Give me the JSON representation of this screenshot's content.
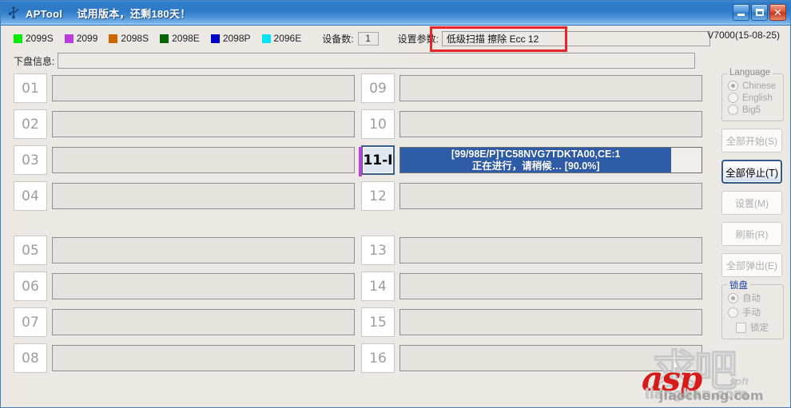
{
  "window": {
    "title": "APTool",
    "trial_notice": "试用版本，还剩180天！",
    "icon": "usb-device-icon",
    "minimize_label": "",
    "maximize_label": "",
    "close_label": "✕"
  },
  "legend": {
    "items": [
      {
        "label": "2099S",
        "color": "#00ef00"
      },
      {
        "label": "2099",
        "color": "#bb3ddb"
      },
      {
        "label": "2098S",
        "color": "#cc6600"
      },
      {
        "label": "2098E",
        "color": "#006600"
      },
      {
        "label": "2098P",
        "color": "#0000cc"
      },
      {
        "label": "2096E",
        "color": "#00e5f5"
      }
    ]
  },
  "toolbar": {
    "device_count_label": "设备数:",
    "device_count_value": "1",
    "param_label": "设置参数:",
    "param_value": "低级扫描 擦除 Ecc 12",
    "param_highlight_color": "#e8242b",
    "version": "V7000(15-08-25)"
  },
  "info": {
    "label": "下盘信息:",
    "value": ""
  },
  "slots": {
    "group1": {
      "left": [
        {
          "num": "01",
          "text": "",
          "active": false
        },
        {
          "num": "02",
          "text": "",
          "active": false
        },
        {
          "num": "03",
          "text": "",
          "active": false
        },
        {
          "num": "04",
          "text": "",
          "active": false
        }
      ],
      "right": [
        {
          "num": "09",
          "text": "",
          "active": false
        },
        {
          "num": "10",
          "text": "",
          "active": false
        },
        {
          "num": "11-I",
          "active": true,
          "line1": "[99/98E/P]TC58NVG7TDKTA00,CE:1",
          "line2": "正在进行，请稍候… [90.0%]",
          "progress": 90,
          "stripe_color": "#c23fd8",
          "bar_color": "#2e5ca8"
        },
        {
          "num": "12",
          "text": "",
          "active": false
        }
      ]
    },
    "group2": {
      "left": [
        {
          "num": "05",
          "text": "",
          "active": false
        },
        {
          "num": "06",
          "text": "",
          "active": false
        },
        {
          "num": "07",
          "text": "",
          "active": false
        },
        {
          "num": "08",
          "text": "",
          "active": false
        }
      ],
      "right": [
        {
          "num": "13",
          "text": "",
          "active": false
        },
        {
          "num": "14",
          "text": "",
          "active": false
        },
        {
          "num": "15",
          "text": "",
          "active": false
        },
        {
          "num": "16",
          "text": "",
          "active": false
        }
      ]
    }
  },
  "sidebar": {
    "language": {
      "title": "Language",
      "options": [
        {
          "label": "Chinese",
          "selected": true
        },
        {
          "label": "English",
          "selected": false
        },
        {
          "label": "Big5",
          "selected": false
        }
      ]
    },
    "buttons": [
      {
        "label": "全部开始(S)",
        "enabled": false
      },
      {
        "label": "全部停止(T)",
        "enabled": true
      },
      {
        "label": "设置(M)",
        "enabled": false
      },
      {
        "label": "刷新(R)",
        "enabled": false
      },
      {
        "label": "全部弹出(E)",
        "enabled": false
      }
    ],
    "lock": {
      "title": "锁盘",
      "options": [
        {
          "label": "自动",
          "selected": true
        },
        {
          "label": "手动",
          "selected": false
        }
      ],
      "checkbox": {
        "label": "锁定",
        "checked": false
      }
    }
  },
  "watermark": {
    "grey_text": "求吧",
    "red_text": "asp",
    "url_text": "jiaocheng.com",
    "url_text2": "lianghan.com",
    "soft_text": "soft"
  }
}
